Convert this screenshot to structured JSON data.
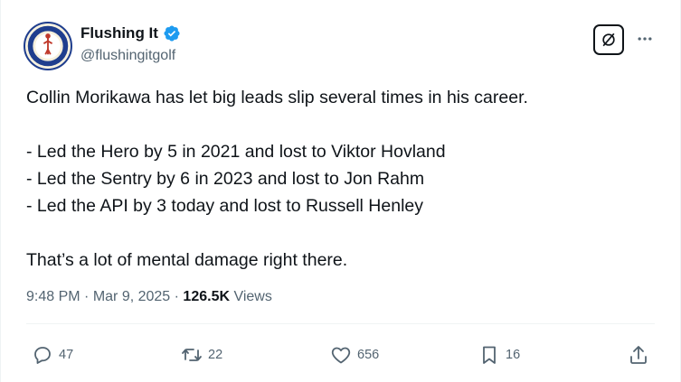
{
  "author": {
    "name": "Flushing It",
    "handle": "@flushingitgolf",
    "avatar_text_top": "FLUSHING",
    "avatar_text_bottom": "IT",
    "verified": true
  },
  "tweet": {
    "lines": [
      "Collin Morikawa has let big leads slip several times in his career.",
      "",
      "- Led the Hero by 5 in 2021 and lost to Viktor Hovland",
      "- Led the Sentry by 6 in 2023 and lost to Jon Rahm",
      "- Led the API by 3 today and lost to Russell Henley",
      "",
      "That’s a lot of mental damage right there."
    ]
  },
  "meta": {
    "time": "9:48 PM",
    "separator": " · ",
    "date": "Mar 9, 2025",
    "views_count": "126.5K",
    "views_label": " Views"
  },
  "actions": {
    "replies": "47",
    "reposts": "22",
    "likes": "656",
    "bookmarks": "16"
  },
  "colors": {
    "text": "#0f1419",
    "secondary": "#536471",
    "verified": "#1d9bf0",
    "divider": "#eff3f4"
  },
  "icons": [
    "verified-badge-icon",
    "grok-icon",
    "more-icon",
    "reply-icon",
    "repost-icon",
    "like-icon",
    "bookmark-icon",
    "share-icon"
  ]
}
